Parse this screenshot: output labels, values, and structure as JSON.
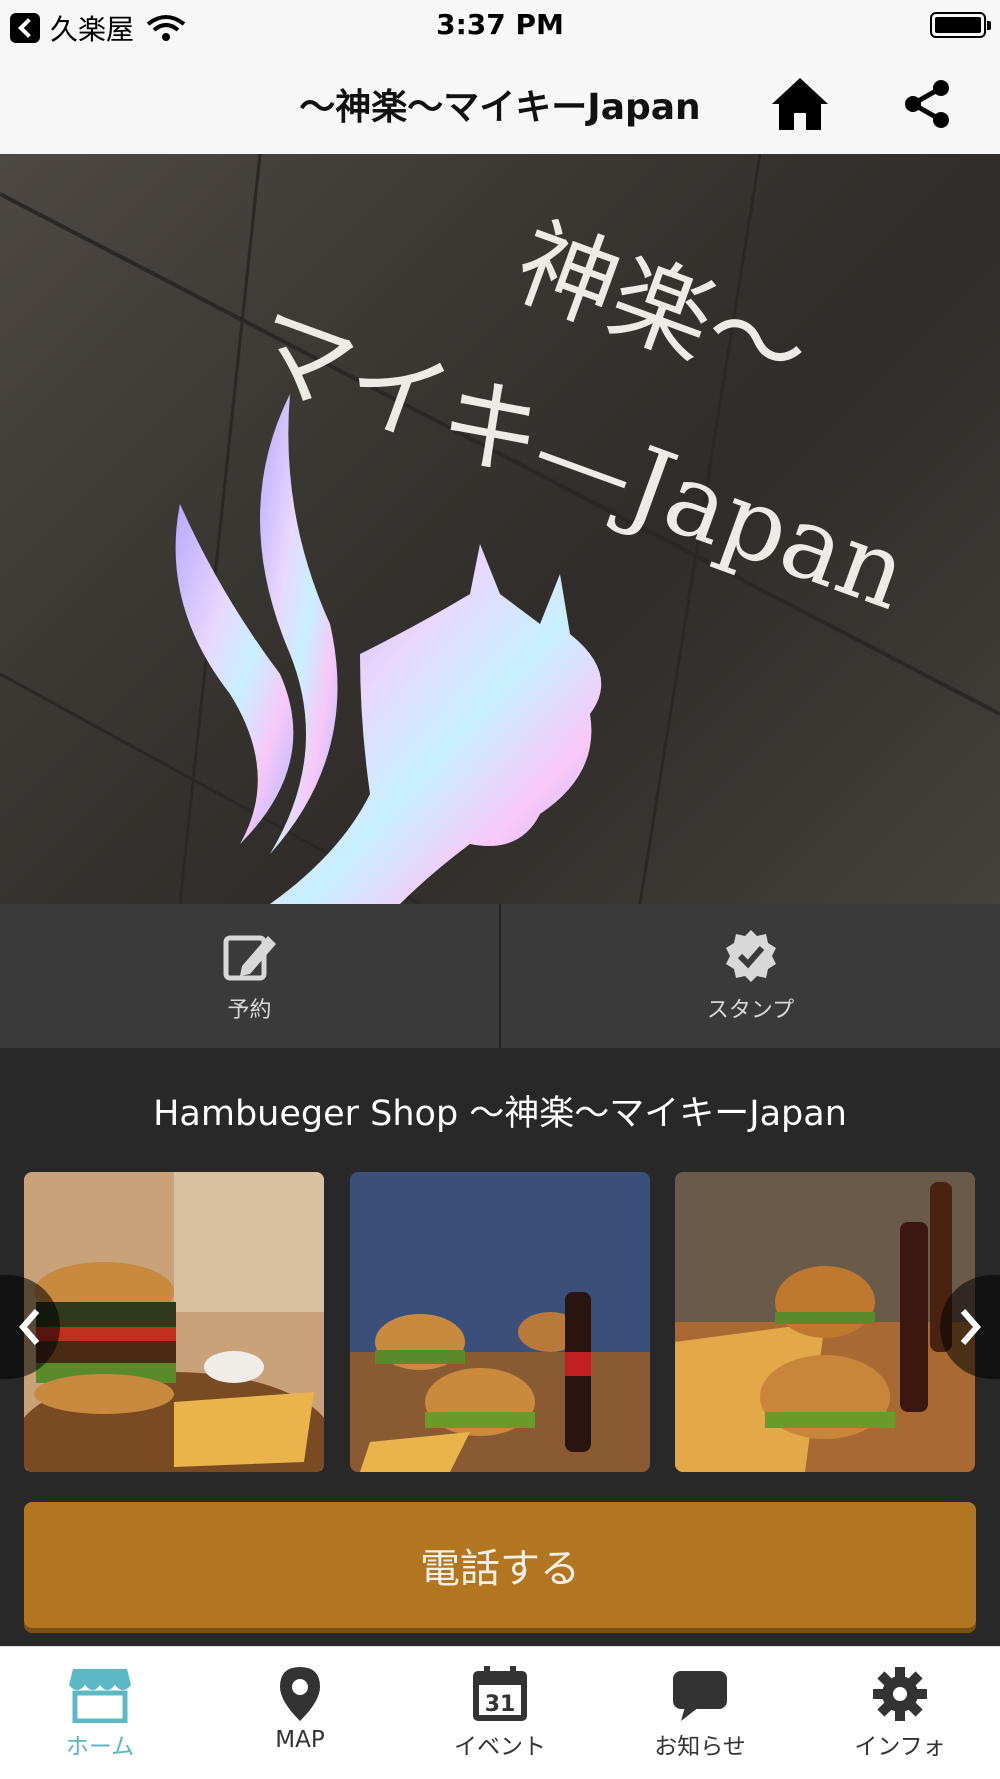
{
  "status_bar": {
    "carrier": "久楽屋",
    "time": "3:37 PM"
  },
  "header": {
    "title": "〜神楽〜マイキーJapan",
    "home_icon": "home-icon",
    "share_icon": "share-icon"
  },
  "hero": {
    "sign_text_line1": "〜神楽〜",
    "sign_text_line2": "マイキーJapan"
  },
  "actions": [
    {
      "label": "予約",
      "icon": "pencil-edit-icon"
    },
    {
      "label": "スタンプ",
      "icon": "badge-check-icon"
    }
  ],
  "shop_title": "Hambueger Shop 〜神楽〜マイキーJapan",
  "gallery": {
    "photos": [
      "burger-photo-1",
      "burger-photo-2",
      "burger-photo-3"
    ]
  },
  "call_button": {
    "label": "電話する"
  },
  "tabs": [
    {
      "label": "ホーム",
      "icon": "store-icon",
      "active": true
    },
    {
      "label": "MAP",
      "icon": "map-pin-icon",
      "active": false
    },
    {
      "label": "イベント",
      "icon": "calendar-icon",
      "active": false,
      "calendar_day": "31"
    },
    {
      "label": "お知らせ",
      "icon": "speech-bubble-icon",
      "active": false
    },
    {
      "label": "インフォ",
      "icon": "gear-icon",
      "active": false
    }
  ],
  "colors": {
    "accent": "#5bb8c4",
    "call_button": "#b27620",
    "background": "#282828"
  }
}
